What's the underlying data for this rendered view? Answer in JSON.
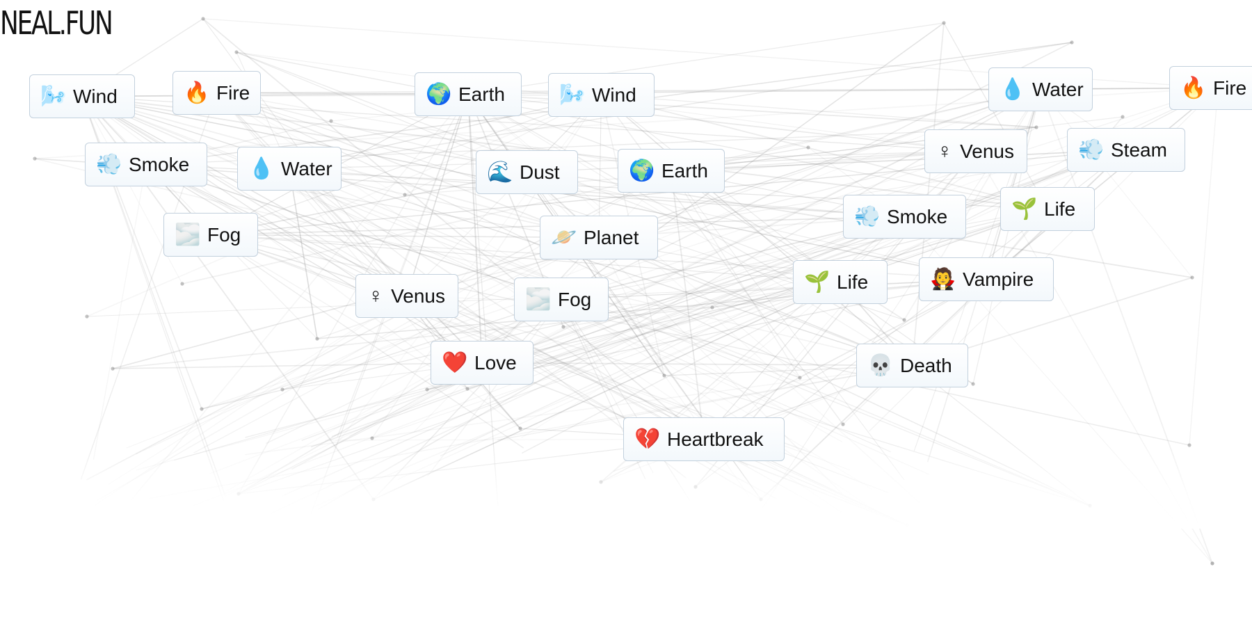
{
  "app": {
    "logo_text": "NEAL.FUN"
  },
  "colors": {
    "background": "#ffffff",
    "tile_border": "#c2d0dd",
    "tile_fill_top": "#ffffff",
    "tile_fill_bottom": "#f3f8fc",
    "text": "#111111",
    "link_line": "#8f8f8f",
    "node_dot": "#9a9a9a"
  },
  "elements": [
    {
      "id": "wind-1",
      "label": "Wind",
      "emoji": "🌬️",
      "icon": "wind-icon"
    },
    {
      "id": "fire-1",
      "label": "Fire",
      "emoji": "🔥",
      "icon": "fire-icon"
    },
    {
      "id": "earth-1",
      "label": "Earth",
      "emoji": "🌍",
      "icon": "earth-globe-icon"
    },
    {
      "id": "wind-2",
      "label": "Wind",
      "emoji": "🌬️",
      "icon": "wind-icon"
    },
    {
      "id": "water-1",
      "label": "Water",
      "emoji": "💧",
      "icon": "water-drop-icon"
    },
    {
      "id": "fire-2",
      "label": "Fire",
      "emoji": "🔥",
      "icon": "fire-icon"
    },
    {
      "id": "smoke-1",
      "label": "Smoke",
      "emoji": "💨",
      "icon": "smoke-puff-icon"
    },
    {
      "id": "water-2",
      "label": "Water",
      "emoji": "💧",
      "icon": "water-drop-icon"
    },
    {
      "id": "dust-1",
      "label": "Dust",
      "emoji": "🌊",
      "icon": "dust-waves-icon"
    },
    {
      "id": "earth-2",
      "label": "Earth",
      "emoji": "🌍",
      "icon": "earth-globe-icon"
    },
    {
      "id": "venus-1",
      "label": "Venus",
      "emoji": "♀",
      "icon": "venus-symbol-icon"
    },
    {
      "id": "steam-1",
      "label": "Steam",
      "emoji": "💨",
      "icon": "steam-puff-icon"
    },
    {
      "id": "fog-1",
      "label": "Fog",
      "emoji": "🌫️",
      "icon": "fog-waves-icon"
    },
    {
      "id": "planet-1",
      "label": "Planet",
      "emoji": "🪐",
      "icon": "planet-ringed-icon"
    },
    {
      "id": "smoke-2",
      "label": "Smoke",
      "emoji": "💨",
      "icon": "smoke-puff-icon"
    },
    {
      "id": "life-1",
      "label": "Life",
      "emoji": "🌱",
      "icon": "sprout-icon"
    },
    {
      "id": "venus-2",
      "label": "Venus",
      "emoji": "♀",
      "icon": "venus-symbol-icon"
    },
    {
      "id": "fog-2",
      "label": "Fog",
      "emoji": "🌫️",
      "icon": "fog-waves-icon"
    },
    {
      "id": "life-2",
      "label": "Life",
      "emoji": "🌱",
      "icon": "sprout-icon"
    },
    {
      "id": "vampire-1",
      "label": "Vampire",
      "emoji": "🧛",
      "icon": "vampire-icon"
    },
    {
      "id": "love-1",
      "label": "Love",
      "emoji": "❤️",
      "icon": "red-heart-icon"
    },
    {
      "id": "death-1",
      "label": "Death",
      "emoji": "💀",
      "icon": "skull-icon"
    },
    {
      "id": "heartbreak-1",
      "label": "Heartbreak",
      "emoji": "💔",
      "icon": "broken-heart-icon"
    }
  ]
}
